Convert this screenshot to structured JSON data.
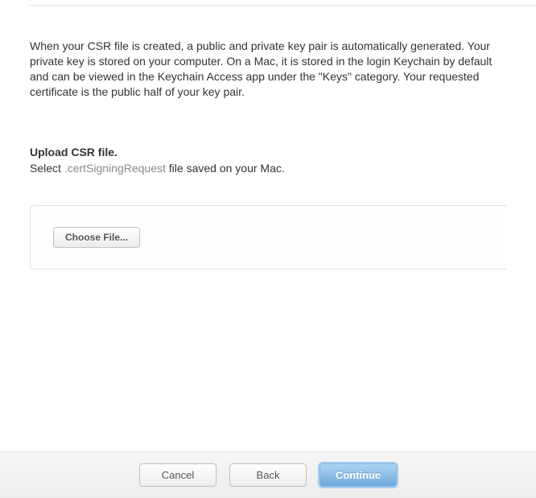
{
  "main": {
    "description": "When your CSR file is created, a public and private key pair is automatically generated. Your private key is stored on your computer. On a Mac, it is stored in the login Keychain by default and can be viewed in the Keychain Access app under the \"Keys\" category. Your requested certificate is the public half of your key pair.",
    "uploadHeading": "Upload CSR file.",
    "uploadPrefix": "Select ",
    "uploadExt": ".certSigningRequest",
    "uploadSuffix": " file saved on your Mac.",
    "chooseFileLabel": "Choose File..."
  },
  "footer": {
    "cancel": "Cancel",
    "back": "Back",
    "continue": "Continue"
  }
}
